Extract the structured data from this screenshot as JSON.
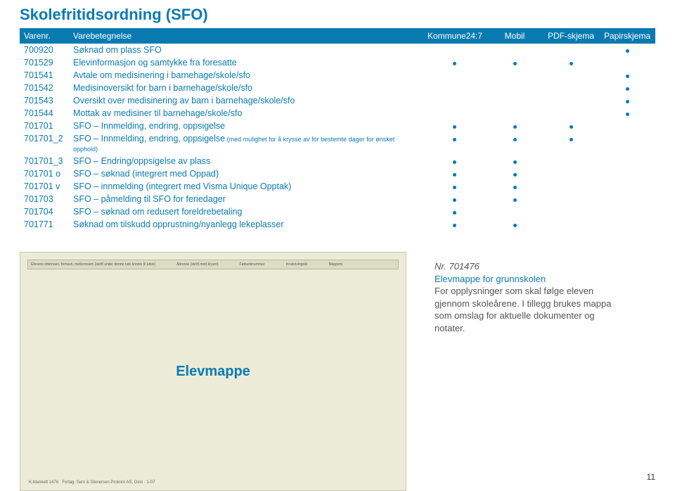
{
  "section_title": "Skolefritidsordning (SFO)",
  "table": {
    "headers": {
      "varenr": "Varenr.",
      "varebetegnelse": "Varebetegnelse",
      "kommune": "Kommune24:7",
      "mobil": "Mobil",
      "pdf": "PDF-skjema",
      "papir": "Papirskjema"
    },
    "rows": [
      {
        "num": "700920",
        "name": "Søknad om plass SFO",
        "note": "",
        "k": false,
        "m": false,
        "pdf": false,
        "p": true
      },
      {
        "num": "701529",
        "name": "Elevinformasjon og samtykke fra foresatte",
        "note": "",
        "k": true,
        "m": true,
        "pdf": true,
        "p": false
      },
      {
        "num": "701541",
        "name": "Avtale om medisinering i barnehage/skole/sfo",
        "note": "",
        "k": false,
        "m": false,
        "pdf": false,
        "p": true
      },
      {
        "num": "701542",
        "name": "Medisinoversikt for barn i barnehage/skole/sfo",
        "note": "",
        "k": false,
        "m": false,
        "pdf": false,
        "p": true
      },
      {
        "num": "701543",
        "name": "Oversikt over medisinering av barn i barnehage/skole/sfo",
        "note": "",
        "k": false,
        "m": false,
        "pdf": false,
        "p": true
      },
      {
        "num": "701544",
        "name": "Mottak av medisiner til barnehage/skole/sfo",
        "note": "",
        "k": false,
        "m": false,
        "pdf": false,
        "p": true
      },
      {
        "num": "701701",
        "name": "SFO – Innmelding, endring, oppsigelse",
        "note": "",
        "k": true,
        "m": true,
        "pdf": true,
        "p": false
      },
      {
        "num": "701701_2",
        "name": "SFO – Innmelding, endring, oppsigelse",
        "note": " (med mulighet for å krysse av for bestemte dager for ønsket opphold)",
        "k": true,
        "m": true,
        "pdf": true,
        "p": false
      },
      {
        "num": "701701_3",
        "name": "SFO – Endring/oppsigelse av plass",
        "note": "",
        "k": true,
        "m": true,
        "pdf": false,
        "p": false
      },
      {
        "num": "701701 o",
        "name": "SFO – søknad (integrert med Oppad)",
        "note": "",
        "k": true,
        "m": true,
        "pdf": false,
        "p": false
      },
      {
        "num": "701701 v",
        "name": "SFO – innmelding (integrert med Visma Unique Opptak)",
        "note": "",
        "k": true,
        "m": true,
        "pdf": false,
        "p": false
      },
      {
        "num": "701703",
        "name": "SFO – påmelding til SFO for feriedager",
        "note": "",
        "k": true,
        "m": true,
        "pdf": false,
        "p": false
      },
      {
        "num": "701704",
        "name": "SFO – søknad om redusert foreldrebetaling",
        "note": "",
        "k": true,
        "m": false,
        "pdf": false,
        "p": false
      },
      {
        "num": "701771",
        "name": "Søknad om tilskudd opprustning/nyanlegg lekeplasser",
        "note": "",
        "k": true,
        "m": true,
        "pdf": false,
        "p": false
      }
    ]
  },
  "folder": {
    "center_label": "Elevmappe",
    "strip_left": "Elevens etternavn, fornavn, mellomnavn (skrift under denne rute kreves til arkiv)",
    "strip_mid": "Adresse (skrift med blyant)",
    "strip_r1": "Fødselsnummer",
    "strip_r2": "Innskrivingsår",
    "strip_r3": "Mappenr.",
    "footer": "K-blankett 1476 · Forlag: Sem & Stenersen Prokom AS, Oslo · 1-07"
  },
  "sidebar": {
    "prodnum": "Nr. 701476",
    "prodtitle": "Elevmappe for grunnskolen",
    "body": "For opplysninger som skal følge eleven gjennom skoleårene. I tillegg brukes mappa som omslag for aktuelle dokumenter og notater."
  },
  "page_number": "11"
}
